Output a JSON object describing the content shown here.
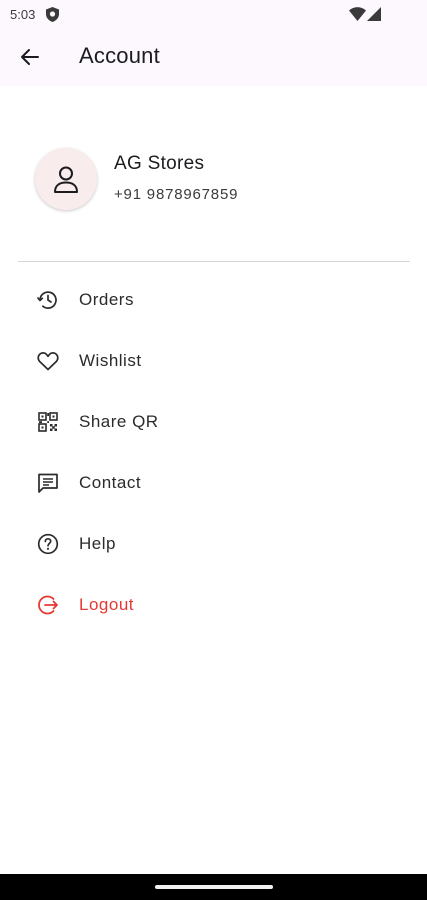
{
  "status_bar": {
    "time": "5:03",
    "icons": [
      "shield-icon",
      "wifi-icon",
      "signal-icon"
    ]
  },
  "app_bar": {
    "title": "Account",
    "back_icon": "arrow-back-icon"
  },
  "profile": {
    "name": "AG Stores",
    "phone": "+91 9878967859",
    "avatar_icon": "person-icon"
  },
  "menu": {
    "items": [
      {
        "label": "Orders",
        "icon": "history-icon"
      },
      {
        "label": "Wishlist",
        "icon": "heart-icon"
      },
      {
        "label": "Share QR",
        "icon": "qr-code-icon"
      },
      {
        "label": "Contact",
        "icon": "chat-icon"
      },
      {
        "label": "Help",
        "icon": "help-circle-icon"
      },
      {
        "label": "Logout",
        "icon": "logout-icon",
        "color": "#e53935"
      }
    ]
  },
  "colors": {
    "app_bar_bg": "#fdf8fd",
    "logout": "#e53935",
    "avatar_bg": "#f9ecec"
  }
}
